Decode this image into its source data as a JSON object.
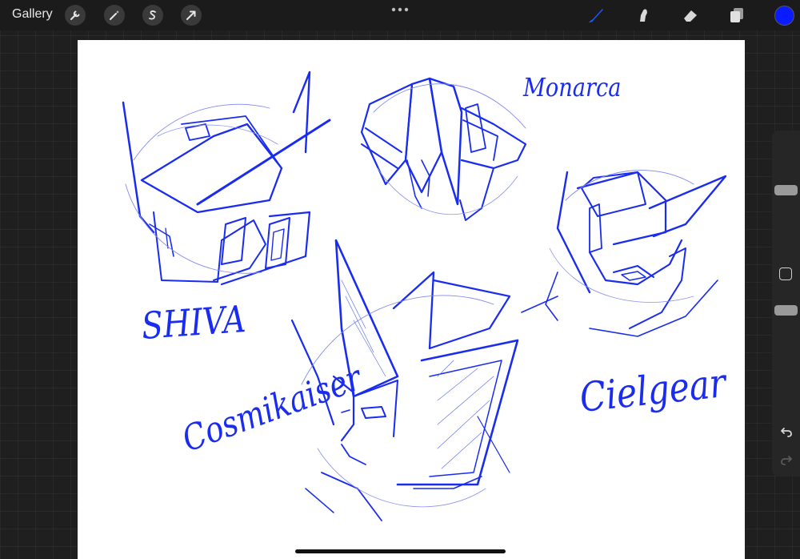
{
  "app": {
    "gallery_label": "Gallery"
  },
  "toolbar_left": [
    "wrench-icon",
    "magic-wand-icon",
    "selection-s-icon",
    "transform-arrow-icon"
  ],
  "toolbar_right": [
    "brush-icon",
    "smudge-icon",
    "eraser-icon",
    "layers-icon"
  ],
  "colors": {
    "active_brush": "#1d5bff",
    "current_color": "#0a1bff",
    "ink": "#1a2cf0"
  },
  "canvas": {
    "labels": {
      "shiva": "SHIVA",
      "monarca": "Monarca",
      "cielgear": "Cielgear",
      "cosmikaiser": "Cosmikaiser"
    }
  },
  "sidebar": {
    "size_slider_level": 0.5,
    "opacity_slider_level": 1.0
  }
}
